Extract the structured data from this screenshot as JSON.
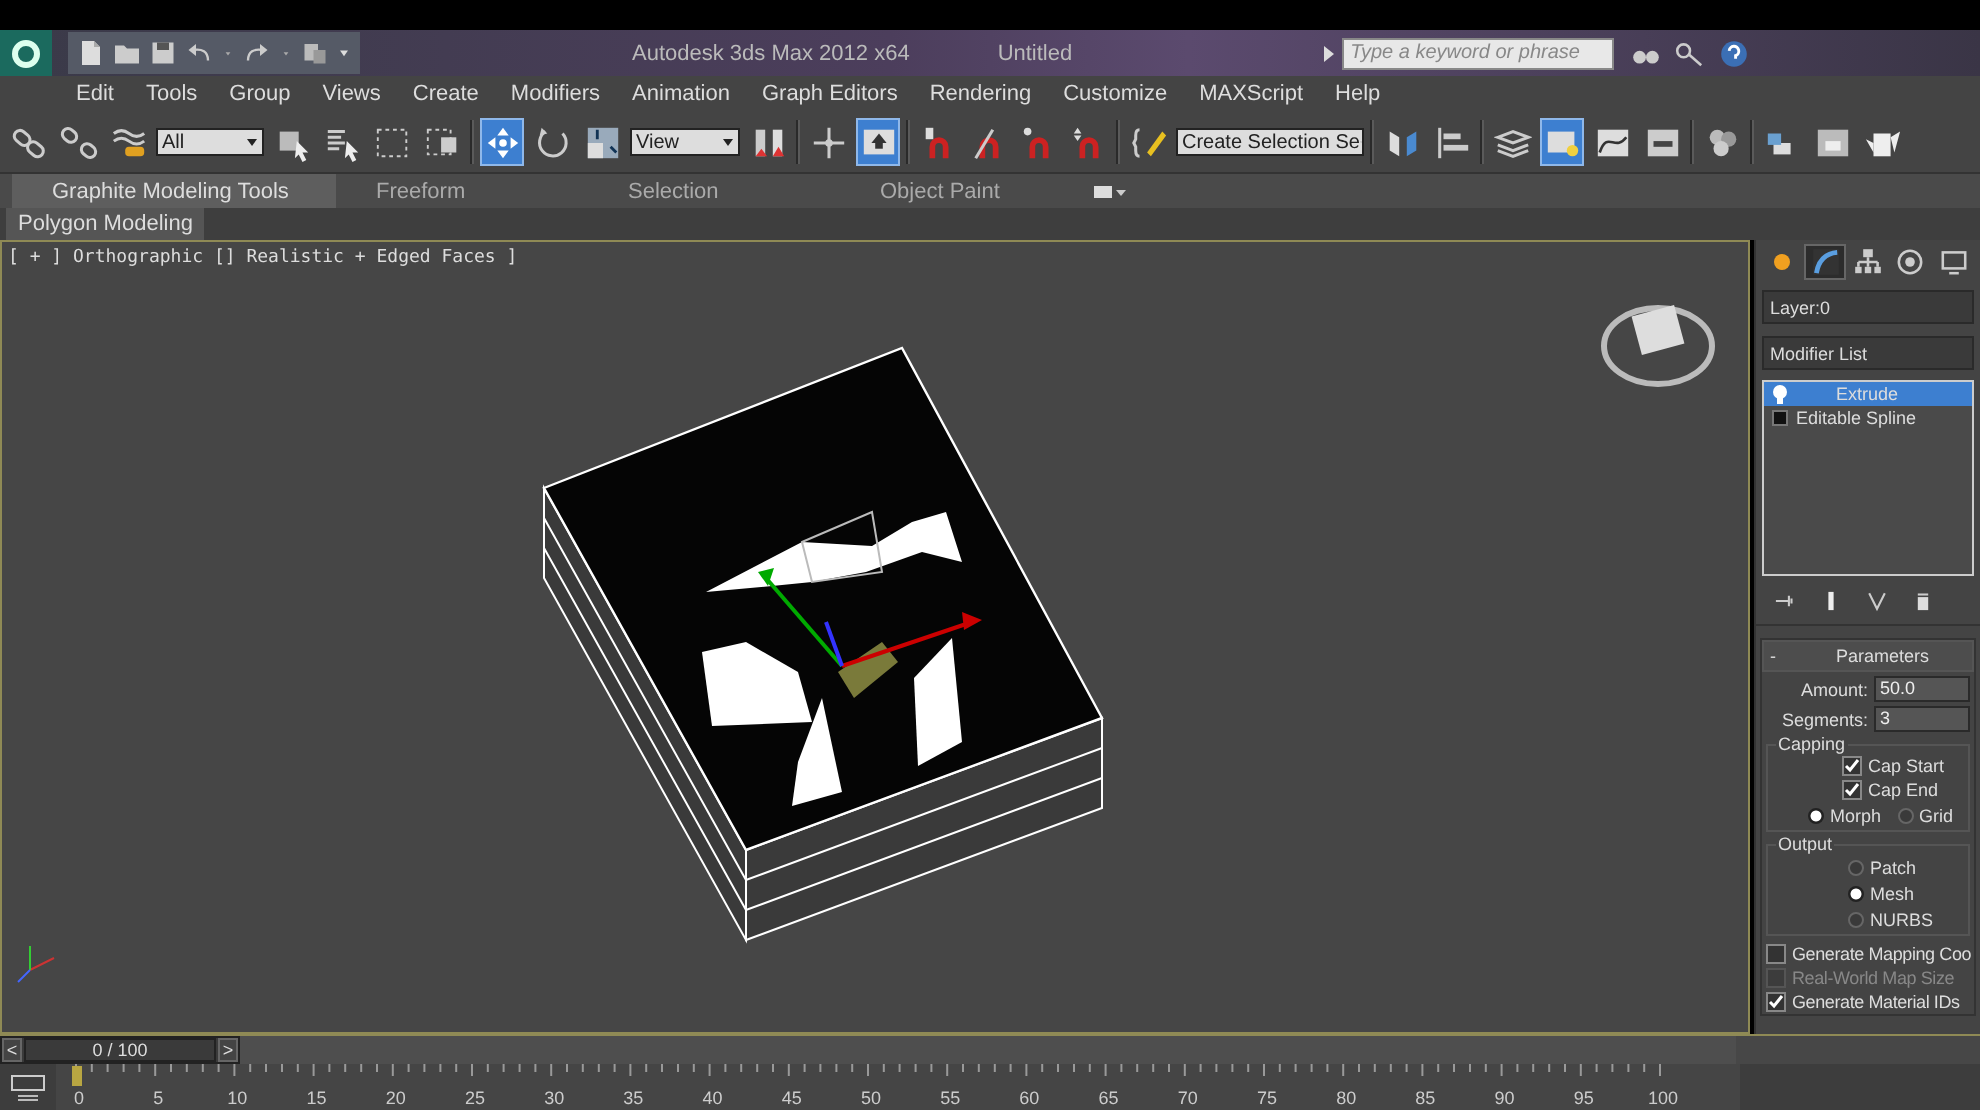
{
  "title_bar": {
    "quick_access": [
      {
        "kind": "new"
      },
      {
        "kind": "open"
      },
      {
        "kind": "save"
      },
      {
        "kind": "undo"
      },
      {
        "kind": "menu-arrow"
      },
      {
        "kind": "redo"
      },
      {
        "kind": "menu-arrow"
      },
      {
        "kind": "project"
      },
      {
        "kind": "dropdown"
      }
    ],
    "app_title": "Autodesk 3ds Max  2012 x64",
    "document": "Untitled",
    "search": {
      "placeholder": "Type a keyword or phrase"
    },
    "info_tools": [
      {
        "kind": "binoculars"
      },
      {
        "kind": "key"
      },
      {
        "kind": "help"
      }
    ]
  },
  "menu": [
    "Edit",
    "Tools",
    "Group",
    "Views",
    "Create",
    "Modifiers",
    "Animation",
    "Graph Editors",
    "Rendering",
    "Customize",
    "MAXScript",
    "Help"
  ],
  "toolbar": {
    "items": [
      {
        "kind": "link",
        "selected": false
      },
      {
        "kind": "unlink",
        "selected": false
      },
      {
        "kind": "bind",
        "selected": false
      },
      {
        "kind": "dropdown",
        "value": "All"
      },
      {
        "kind": "select",
        "selected": false
      },
      {
        "kind": "select-list",
        "selected": false
      },
      {
        "kind": "rect-select",
        "selected": false
      },
      {
        "kind": "window",
        "selected": false
      },
      {
        "kind": "separator"
      },
      {
        "kind": "move",
        "selected": true
      },
      {
        "kind": "rotate",
        "selected": false
      },
      {
        "kind": "scale",
        "selected": false
      },
      {
        "kind": "dropdown",
        "value": "View"
      },
      {
        "kind": "pivot",
        "selected": false
      },
      {
        "kind": "separator"
      },
      {
        "kind": "manipulate",
        "selected": false
      },
      {
        "kind": "shortcut",
        "selected": true
      },
      {
        "kind": "separator"
      },
      {
        "kind": "snap",
        "selected": false
      },
      {
        "kind": "angle-snap",
        "selected": false
      },
      {
        "kind": "percent-snap",
        "selected": false
      },
      {
        "kind": "spinner-snap",
        "selected": false
      },
      {
        "kind": "separator"
      },
      {
        "kind": "named-sets",
        "selected": false
      },
      {
        "kind": "dropdown",
        "value": "Create Selection Se"
      },
      {
        "kind": "separator"
      },
      {
        "kind": "mirror",
        "selected": false
      },
      {
        "kind": "align",
        "selected": false
      },
      {
        "kind": "separator"
      },
      {
        "kind": "layers",
        "selected": false
      },
      {
        "kind": "ribbon-toggle",
        "selected": true
      },
      {
        "kind": "curve-editor",
        "selected": false
      },
      {
        "kind": "schematic",
        "selected": false
      },
      {
        "kind": "separator"
      },
      {
        "kind": "material",
        "selected": false
      },
      {
        "kind": "separator"
      },
      {
        "kind": "render-setup",
        "selected": false
      },
      {
        "kind": "frame-window",
        "selected": false
      },
      {
        "kind": "render",
        "selected": false
      }
    ]
  },
  "ribbon": {
    "tabs": [
      {
        "label": "Graphite Modeling Tools",
        "selected": true
      },
      {
        "label": "Freeform",
        "selected": false
      },
      {
        "label": "Selection",
        "selected": false
      },
      {
        "label": "Object Paint",
        "selected": false
      }
    ],
    "panel": "Polygon Modeling"
  },
  "viewport": {
    "label": "[ + ] Orthographic [] Realistic + Edged Faces ]"
  },
  "command_panel": {
    "tabs": [
      {
        "kind": "create",
        "selected": false
      },
      {
        "kind": "modify",
        "selected": true
      },
      {
        "kind": "hierarchy",
        "selected": false
      },
      {
        "kind": "motion",
        "selected": false
      },
      {
        "kind": "display",
        "selected": false
      }
    ],
    "layer": "Layer:0",
    "modifier_list": "Modifier List",
    "stack": [
      {
        "label": "Extrude",
        "kind": "modifier",
        "selected": true
      },
      {
        "label": "Editable Spline",
        "kind": "base",
        "selected": false
      }
    ],
    "stack_tools": [
      {
        "kind": "pin"
      },
      {
        "kind": "show-end"
      },
      {
        "kind": "make-unique"
      },
      {
        "kind": "remove"
      }
    ],
    "parameters": {
      "collapse": "-",
      "title": "Parameters",
      "fields": [
        {
          "label": "Amount:",
          "value": "50.0"
        },
        {
          "label": "Segments:",
          "value": "3"
        }
      ],
      "capping": {
        "title": "Capping",
        "checks": [
          {
            "label": "Cap Start",
            "checked": true
          },
          {
            "label": "Cap End",
            "checked": true
          }
        ],
        "radios": [
          {
            "label": "Morph",
            "selected": true
          },
          {
            "label": "Grid",
            "selected": false
          }
        ]
      },
      "output": {
        "title": "Output",
        "radios": [
          {
            "label": "Patch",
            "selected": false
          },
          {
            "label": "Mesh",
            "selected": true
          },
          {
            "label": "NURBS",
            "selected": false
          }
        ]
      },
      "checks": [
        {
          "label": "Generate Mapping Coo",
          "checked": false,
          "disabled": false
        },
        {
          "label": "Real-World Map Size",
          "checked": false,
          "disabled": true
        },
        {
          "label": "Generate Material IDs",
          "checked": true,
          "disabled": false
        }
      ]
    }
  },
  "timeline": {
    "prev": "<",
    "next": ">",
    "time_slider": {
      "label": "0 / 100",
      "level": 0
    },
    "ruler_labels": [
      "0",
      "5",
      "10",
      "15",
      "20",
      "25",
      "30",
      "35",
      "40",
      "45",
      "50",
      "55",
      "60",
      "65",
      "70",
      "75",
      "80",
      "85",
      "90",
      "95",
      "100"
    ]
  }
}
